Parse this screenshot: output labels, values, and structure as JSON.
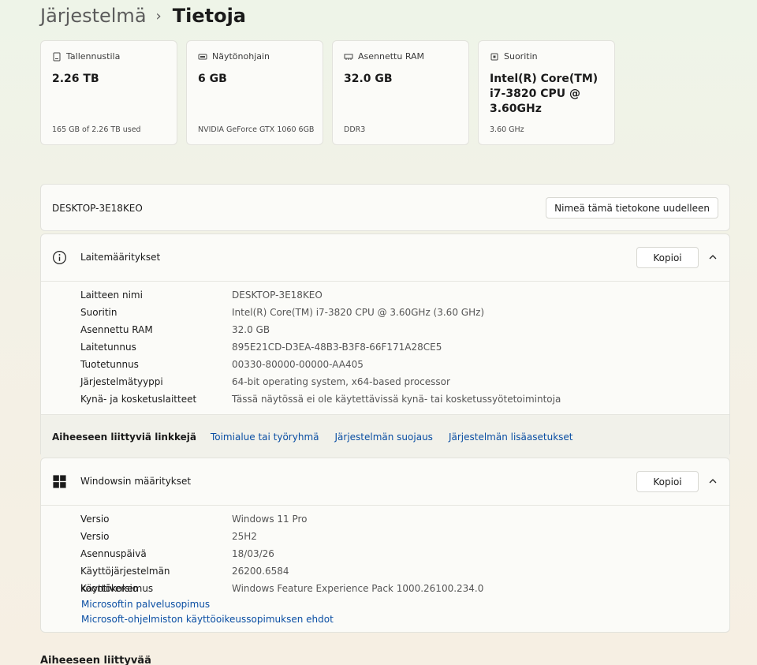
{
  "breadcrumb": {
    "parent": "Järjestelmä",
    "separator": "›",
    "current": "Tietoja"
  },
  "specs": [
    {
      "label": "Tallennustila",
      "value": "2.26 TB",
      "sub": "165 GB of 2.26 TB used",
      "icon": "storage-icon"
    },
    {
      "label": "Näytönohjain",
      "value": "6 GB",
      "sub": "NVIDIA GeForce GTX 1060 6GB",
      "icon": "gpu-icon"
    },
    {
      "label": "Asennettu RAM",
      "value": "32.0 GB",
      "sub": "DDR3",
      "icon": "ram-icon"
    },
    {
      "label": "Suoritin",
      "value": "Intel(R) Core(TM) i7-3820 CPU @ 3.60GHz",
      "sub": "3.60 GHz",
      "icon": "cpu-icon"
    }
  ],
  "device": {
    "name": "DESKTOP-3E18KEO",
    "rename_label": "Nimeä tämä tietokone uudelleen"
  },
  "device_specs": {
    "title": "Laitemääritykset",
    "copy_label": "Kopioi",
    "rows": [
      {
        "label": "Laitteen nimi",
        "value": "DESKTOP-3E18KEO"
      },
      {
        "label": "Suoritin",
        "value": "Intel(R) Core(TM) i7-3820 CPU @ 3.60GHz (3.60 GHz)"
      },
      {
        "label": "Asennettu RAM",
        "value": "32.0 GB"
      },
      {
        "label": "Laitetunnus",
        "value": "895E21CD-D3EA-48B3-B3F8-66F171A28CE5"
      },
      {
        "label": "Tuotetunnus",
        "value": "00330-80000-00000-AA405"
      },
      {
        "label": "Järjestelmätyyppi",
        "value": "64-bit operating system, x64-based processor"
      },
      {
        "label": "Kynä- ja kosketuslaitteet",
        "value": "Tässä näytössä ei ole käytettävissä kynä- tai kosketussyötetoimintoja"
      }
    ]
  },
  "related_links": {
    "label": "Aiheeseen liittyviä linkkejä",
    "links": [
      "Toimialue tai työryhmä",
      "Järjestelmän suojaus",
      "Järjestelmän lisäasetukset"
    ]
  },
  "windows_specs": {
    "title": "Windowsin määritykset",
    "copy_label": "Kopioi",
    "rows": [
      {
        "label": "Versio",
        "value": "Windows 11 Pro"
      },
      {
        "label": "Versio",
        "value": "25H2"
      },
      {
        "label": "Asennuspäivä",
        "value": "18/03/26"
      },
      {
        "label": "Käyttöjärjestelmän koontiversio",
        "value": "26200.6584"
      },
      {
        "label": "Käyttökokemus",
        "value": "Windows Feature Experience Pack 1000.26100.234.0"
      }
    ],
    "links": [
      "Microsoftin palvelusopimus",
      "Microsoft-ohjelmiston käyttöoikeussopimuksen ehdot"
    ]
  },
  "related_heading": "Aiheeseen liittyvää",
  "colors": {
    "link": "#0a4ea3",
    "accent": "#0067c0"
  }
}
